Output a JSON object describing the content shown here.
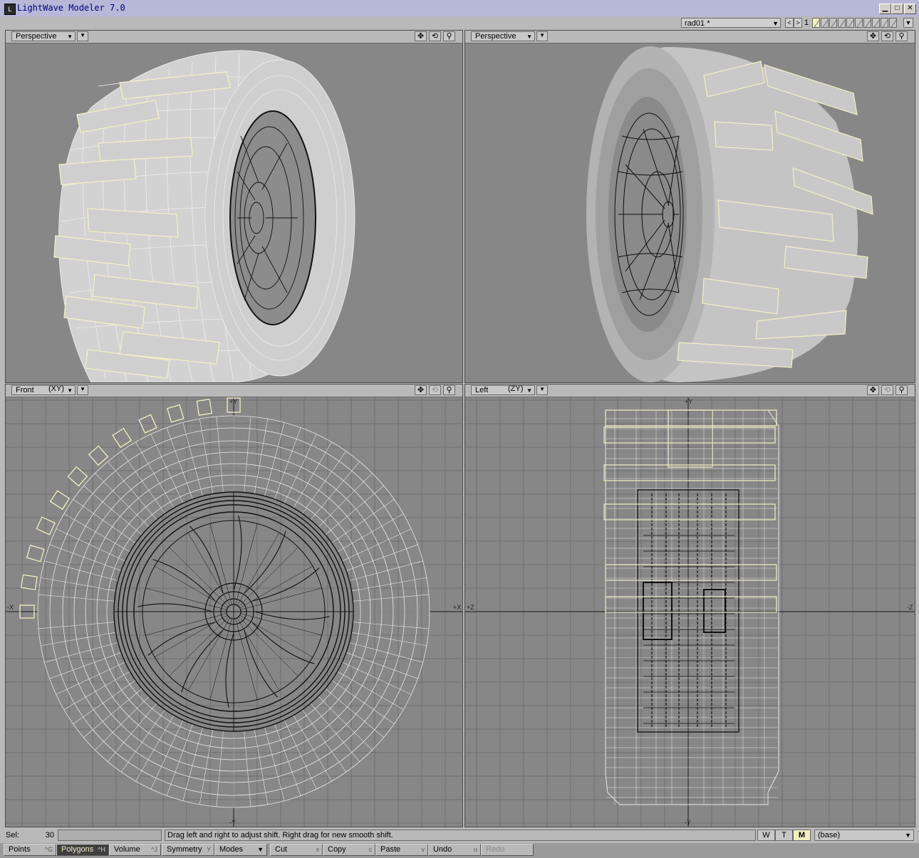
{
  "window": {
    "title": "LightWave Modeler 7.0",
    "minimize": "▁",
    "maximize": "□",
    "close": "✕"
  },
  "topbar": {
    "layer_object": "rad01 *",
    "layer_number": "1",
    "prev": "<",
    "next": ">"
  },
  "viewports": [
    {
      "view": "Perspective",
      "axis": "",
      "render": "wireframe-shaded"
    },
    {
      "view": "Perspective",
      "axis": "",
      "render": "smooth-shaded"
    },
    {
      "view": "Front",
      "axis": "(XY)",
      "render": "wireframe"
    },
    {
      "view": "Left",
      "axis": "(ZY)",
      "render": "wireframe"
    }
  ],
  "axis_labels": {
    "front_top": "+Y",
    "front_bottom": "-Y",
    "front_left": "-X",
    "front_right": "+X",
    "left_top": "+Y",
    "left_bottom": "-Y",
    "left_left": "+Z",
    "left_right": "-Z"
  },
  "status": {
    "sel_label": "Sel:",
    "sel_count": "30",
    "hint": "Drag left and right to adjust shift. Right drag for new smooth shift.",
    "w": "W",
    "t": "T",
    "m": "M",
    "layer": "(base)"
  },
  "toolbar": {
    "points": "Points",
    "points_key": "^G",
    "polygons": "Polygons",
    "polygons_key": "^H",
    "volume": "Volume",
    "volume_key": "^J",
    "symmetry": "Symmetry",
    "symmetry_key": "Y",
    "modes": "Modes",
    "cut": "Cut",
    "cut_key": "x",
    "copy": "Copy",
    "copy_key": "c",
    "paste": "Paste",
    "paste_key": "v",
    "undo": "Undo",
    "undo_key": "u",
    "redo": "Redo"
  },
  "colors": {
    "viewport_bg": "#878787",
    "selected": "#f4efc4",
    "wire": "#e8e8e8",
    "rim": "#101010",
    "grid": "#6f6f6f"
  }
}
